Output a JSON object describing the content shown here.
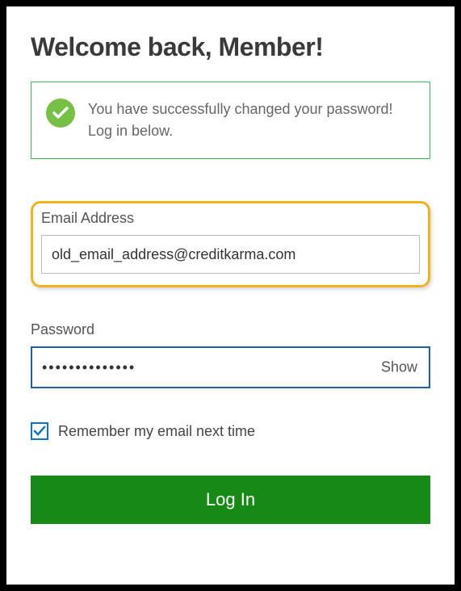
{
  "title": "Welcome back, Member!",
  "banner": {
    "message": "You have successfully changed your password! Log in below."
  },
  "email": {
    "label": "Email Address",
    "value": "old_email_address@creditkarma.com"
  },
  "password": {
    "label": "Password",
    "value": "••••••••••••••",
    "show_label": "Show"
  },
  "remember": {
    "label": "Remember my email next time",
    "checked": true
  },
  "login_button": "Log In",
  "colors": {
    "success_green": "#76c043",
    "banner_border": "#3fb85a",
    "highlight": "#f5b020",
    "focus_blue": "#1e5ea8",
    "checkbox_blue": "#0f73c6",
    "button_green": "#178917"
  }
}
